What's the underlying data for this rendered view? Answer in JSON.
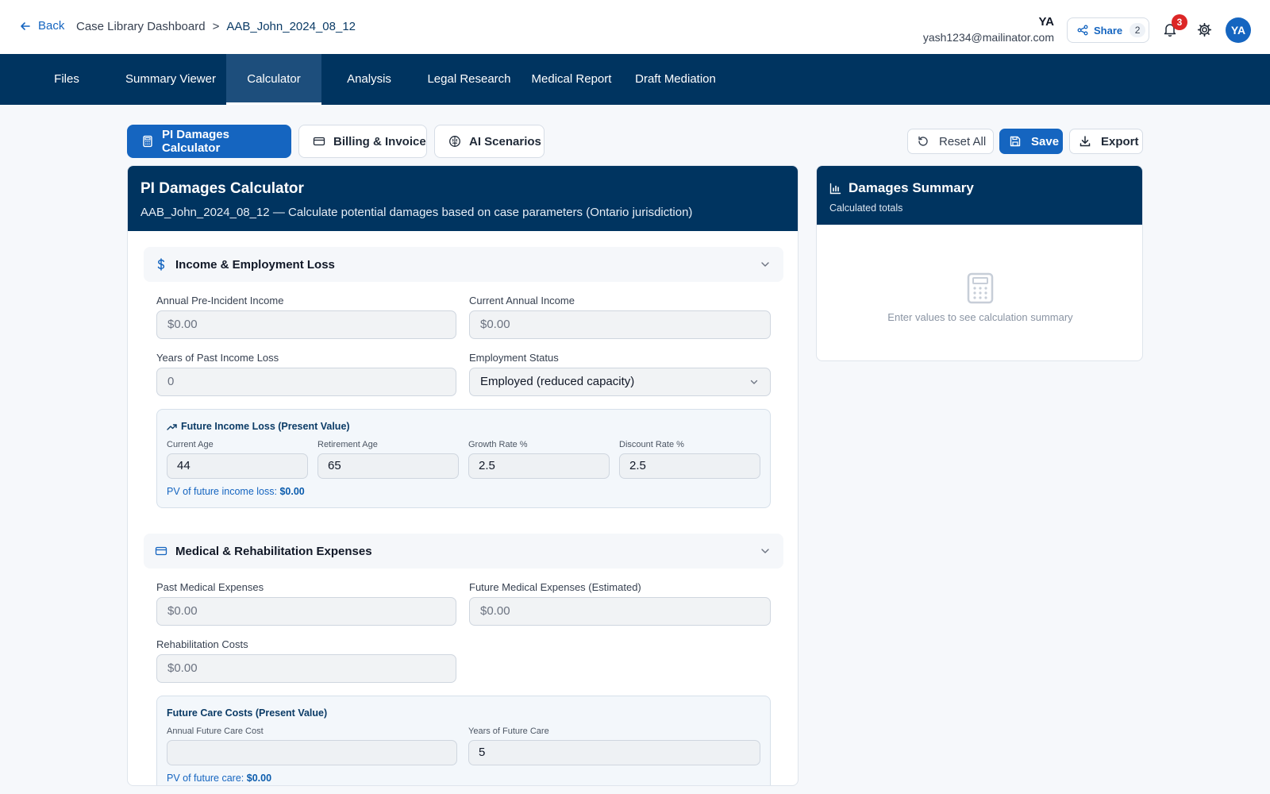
{
  "header": {
    "back_label": "Back",
    "breadcrumb": {
      "parent": "Case Library Dashboard",
      "separator": ">",
      "current": "AAB_John_2024_08_12"
    },
    "user": {
      "initials": "YA",
      "email": "yash1234@mailinator.com"
    },
    "share": {
      "label": "Share",
      "count": "2"
    },
    "notifications_count": "3",
    "avatar_initials": "YA"
  },
  "nav": {
    "tabs": [
      {
        "label": "Files"
      },
      {
        "label": "Summary Viewer"
      },
      {
        "label": "Calculator",
        "active": true
      },
      {
        "label": "Analysis"
      },
      {
        "label": "Legal Research"
      },
      {
        "label": "Medical Report"
      },
      {
        "label": "Draft Mediation"
      }
    ]
  },
  "subtabs": [
    {
      "label": "PI Damages Calculator",
      "active": true,
      "icon": "calculator-icon"
    },
    {
      "label": "Billing & Invoice",
      "icon": "credit-card-icon"
    },
    {
      "label": "AI Scenarios",
      "icon": "brain-icon"
    }
  ],
  "toolbar": {
    "reset_label": "Reset All",
    "save_label": "Save",
    "export_label": "Export"
  },
  "calculator": {
    "title": "PI Damages Calculator",
    "subtitle": "AAB_John_2024_08_12 — Calculate potential damages based on case parameters (Ontario jurisdiction)",
    "income": {
      "section_title": "Income & Employment Loss",
      "annual_pre_label": "Annual Pre-Incident Income",
      "annual_pre_placeholder": "$0.00",
      "current_annual_label": "Current Annual Income",
      "current_annual_placeholder": "$0.00",
      "years_past_label": "Years of Past Income Loss",
      "years_past_placeholder": "0",
      "employment_label": "Employment Status",
      "employment_value": "Employed (reduced capacity)",
      "future": {
        "title": "Future Income Loss (Present Value)",
        "current_age_label": "Current Age",
        "current_age_value": "44",
        "retirement_age_label": "Retirement Age",
        "retirement_age_value": "65",
        "growth_label": "Growth Rate %",
        "growth_value": "2.5",
        "discount_label": "Discount Rate %",
        "discount_value": "2.5",
        "pv_label": "PV of future income loss:",
        "pv_value": "$0.00"
      }
    },
    "medical": {
      "section_title": "Medical & Rehabilitation Expenses",
      "past_label": "Past Medical Expenses",
      "past_placeholder": "$0.00",
      "future_label": "Future Medical Expenses (Estimated)",
      "future_placeholder": "$0.00",
      "rehab_label": "Rehabilitation Costs",
      "rehab_placeholder": "$0.00",
      "care": {
        "title": "Future Care Costs (Present Value)",
        "annual_label": "Annual Future Care Cost",
        "annual_value": "",
        "years_label": "Years of Future Care",
        "years_value": "5",
        "pv_label": "PV of future care:",
        "pv_value": "$0.00"
      }
    }
  },
  "summary": {
    "title": "Damages Summary",
    "subtitle": "Calculated totals",
    "empty_text": "Enter values to see calculation summary"
  },
  "colors": {
    "navy": "#003460",
    "primary": "#1565c0",
    "badge": "#dc2626"
  }
}
